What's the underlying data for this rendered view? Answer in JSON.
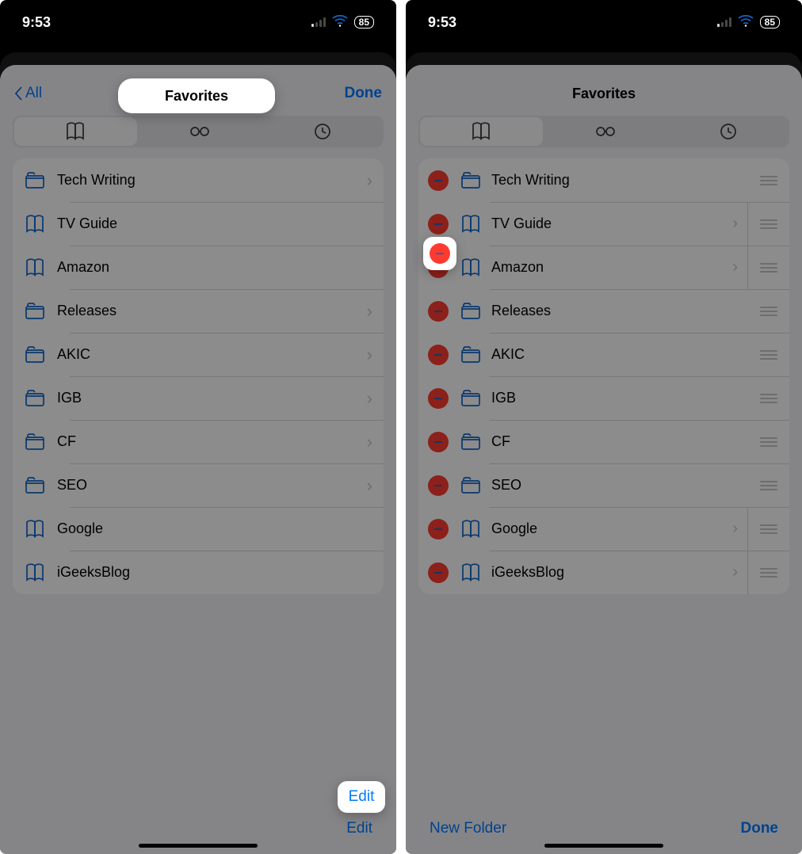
{
  "status": {
    "time": "9:53",
    "battery": "85"
  },
  "nav": {
    "back": "All",
    "title": "Favorites",
    "done": "Done"
  },
  "segments": [
    "bookmarks",
    "reading-list",
    "history"
  ],
  "left": {
    "items": [
      {
        "label": "Tech Writing",
        "type": "folder",
        "disclosure": true
      },
      {
        "label": "TV Guide",
        "type": "bookmark",
        "disclosure": false
      },
      {
        "label": "Amazon",
        "type": "bookmark",
        "disclosure": false
      },
      {
        "label": "Releases",
        "type": "folder",
        "disclosure": true
      },
      {
        "label": "AKIC",
        "type": "folder",
        "disclosure": true
      },
      {
        "label": "IGB",
        "type": "folder",
        "disclosure": true
      },
      {
        "label": "CF",
        "type": "folder",
        "disclosure": true
      },
      {
        "label": "SEO",
        "type": "folder",
        "disclosure": true
      },
      {
        "label": "Google",
        "type": "bookmark",
        "disclosure": false
      },
      {
        "label": "iGeeksBlog",
        "type": "bookmark",
        "disclosure": false
      }
    ],
    "edit": "Edit"
  },
  "right": {
    "items": [
      {
        "label": "Tech Writing",
        "type": "folder",
        "disclosure": false
      },
      {
        "label": "TV Guide",
        "type": "bookmark",
        "disclosure": true
      },
      {
        "label": "Amazon",
        "type": "bookmark",
        "disclosure": true
      },
      {
        "label": "Releases",
        "type": "folder",
        "disclosure": false
      },
      {
        "label": "AKIC",
        "type": "folder",
        "disclosure": false
      },
      {
        "label": "IGB",
        "type": "folder",
        "disclosure": false
      },
      {
        "label": "CF",
        "type": "folder",
        "disclosure": false
      },
      {
        "label": "SEO",
        "type": "folder",
        "disclosure": false
      },
      {
        "label": "Google",
        "type": "bookmark",
        "disclosure": true
      },
      {
        "label": "iGeeksBlog",
        "type": "bookmark",
        "disclosure": true
      }
    ],
    "newfolder": "New Folder",
    "done": "Done"
  }
}
